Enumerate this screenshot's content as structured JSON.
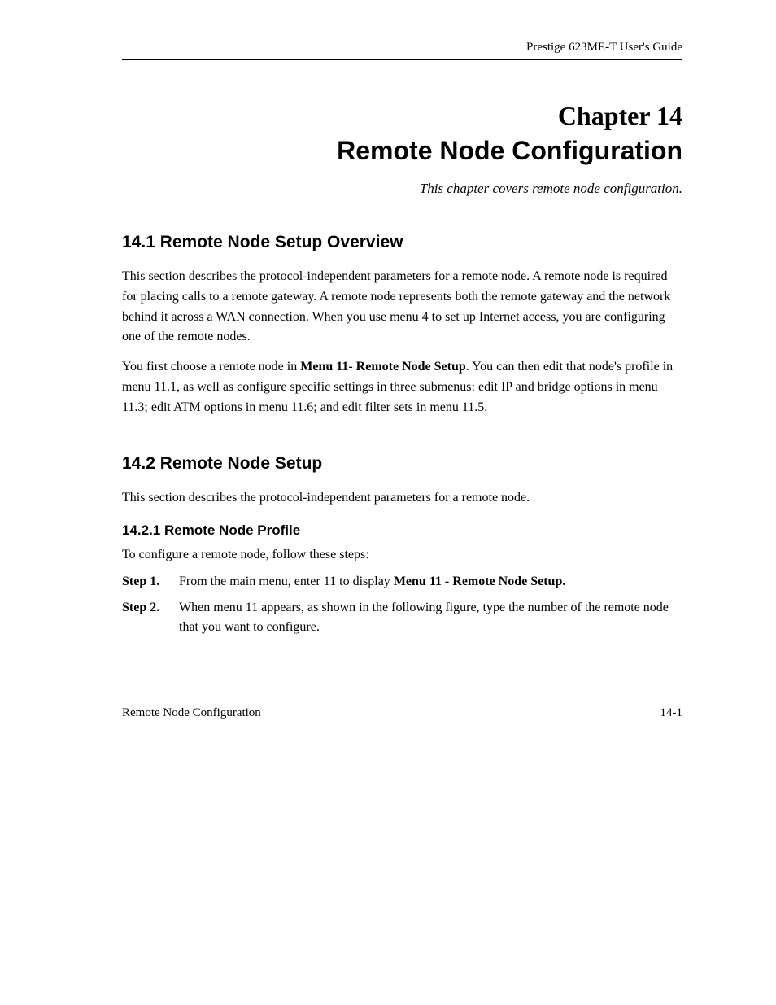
{
  "header": {
    "guide_title": "Prestige 623ME-T User's Guide"
  },
  "chapter": {
    "number": "Chapter 14",
    "title": "Remote Node Configuration",
    "subtitle": "This chapter covers remote node configuration."
  },
  "section_14_1": {
    "heading": "14.1  Remote Node Setup Overview",
    "para1": "This section describes the protocol-independent parameters for a remote node. A remote node is required for placing calls to a remote gateway. A remote node represents both the remote gateway and the network behind it across a WAN connection. When you use menu 4 to set up Internet access, you are configuring one of the remote nodes.",
    "para2_a": "You first choose a remote node in ",
    "para2_bold": "Menu 11- Remote Node Setup",
    "para2_b": ". You can then edit that node's profile in menu 11.1, as well as configure specific settings in three submenus: edit IP and bridge options in menu 11.3; edit ATM options in menu 11.6; and edit filter sets in menu 11.5."
  },
  "section_14_2": {
    "heading": "14.2  Remote Node Setup",
    "para1": "This section describes the protocol-independent parameters for a remote node.",
    "sub_14_2_1": {
      "heading": "14.2.1 Remote Node Profile",
      "intro": "To configure a remote node, follow these steps:",
      "steps": [
        {
          "label": "Step 1.",
          "pre": "From the main menu, enter 11 to display ",
          "bold": "Menu 11 - Remote Node Setup.",
          "post": ""
        },
        {
          "label": "Step 2.",
          "pre": "When menu 11 appears, as shown in the following figure, type the number of the remote node that you want to configure.",
          "bold": "",
          "post": ""
        }
      ]
    }
  },
  "footer": {
    "left": "Remote Node Configuration",
    "right": "14-1"
  }
}
